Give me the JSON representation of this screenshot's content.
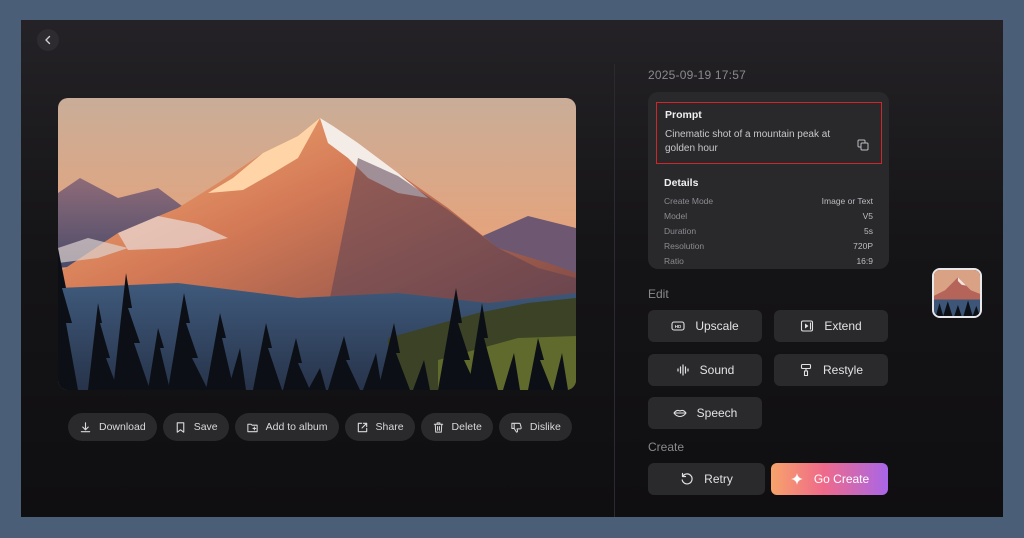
{
  "nav": {
    "back_icon": "chevron-left-icon"
  },
  "image": {
    "alt": "Mountain peak at golden hour",
    "icon": "image-preview"
  },
  "actions": [
    {
      "label": "Download",
      "icon": "download-icon"
    },
    {
      "label": "Save",
      "icon": "bookmark-icon"
    },
    {
      "label": "Add to album",
      "icon": "album-add-icon"
    },
    {
      "label": "Share",
      "icon": "share-icon"
    },
    {
      "label": "Delete",
      "icon": "trash-icon"
    },
    {
      "label": "Dislike",
      "icon": "thumbs-down-icon"
    }
  ],
  "info": {
    "timestamp": "2025-09-19 17:57",
    "prompt_title": "Prompt",
    "prompt_text": "Cinematic shot of a mountain peak at golden hour",
    "details_title": "Details",
    "details": [
      {
        "label": "Create Mode",
        "value": "Image or Text"
      },
      {
        "label": "Model",
        "value": "V5"
      },
      {
        "label": "Duration",
        "value": "5s"
      },
      {
        "label": "Resolution",
        "value": "720P"
      },
      {
        "label": "Ratio",
        "value": "16:9"
      }
    ]
  },
  "edit": {
    "label": "Edit",
    "buttons": [
      {
        "label": "Upscale",
        "icon": "hd-icon"
      },
      {
        "label": "Extend",
        "icon": "extend-icon"
      },
      {
        "label": "Sound",
        "icon": "sound-wave-icon"
      },
      {
        "label": "Restyle",
        "icon": "paint-roller-icon"
      },
      {
        "label": "Speech",
        "icon": "lips-icon"
      }
    ]
  },
  "create": {
    "label": "Create",
    "retry_label": "Retry",
    "go_label": "Go Create"
  },
  "colors": {
    "page_bg": "#4a5e78",
    "panel_bg": "#151416",
    "card_bg": "#29282b",
    "highlight_border": "#d0262a",
    "go_gradient_start": "#f7a36a",
    "go_gradient_end": "#a866e8"
  }
}
